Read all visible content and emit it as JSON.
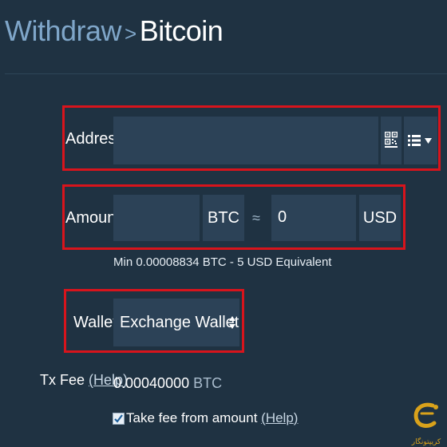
{
  "breadcrumb": {
    "parent": "Withdraw",
    "separator": ">",
    "current": "Bitcoin"
  },
  "address": {
    "label": "Address",
    "value": "",
    "qr_icon": "qr-code-icon",
    "list_icon": "list-icon",
    "caret_icon": "caret-down-icon"
  },
  "amount": {
    "label": "Amount",
    "btc_value": "",
    "btc_unit": "BTC",
    "approx_symbol": "≈",
    "usd_value": "0",
    "usd_unit": "USD",
    "min_hint": "Min 0.00008834 BTC - 5 USD Equivalent"
  },
  "wallet": {
    "label": "Wallet",
    "selected": "Exchange Wallet",
    "arrow_icon": "select-updown-icon"
  },
  "txfee": {
    "label": "Tx Fee",
    "help_open": "(",
    "help_label": "Help",
    "help_close": ")",
    "amount": "0.00040000",
    "unit": "BTC"
  },
  "take_fee": {
    "checked": true,
    "label": "Take fee from amount",
    "help_open": "(",
    "help_label": "Help",
    "help_close": ")"
  },
  "logo": {
    "text": "کریپتونگار"
  },
  "colors": {
    "background": "#1f3242",
    "field": "#2c4257",
    "highlight": "#d8141c",
    "link": "#7fa6c9",
    "logo": "#d9a21b"
  }
}
